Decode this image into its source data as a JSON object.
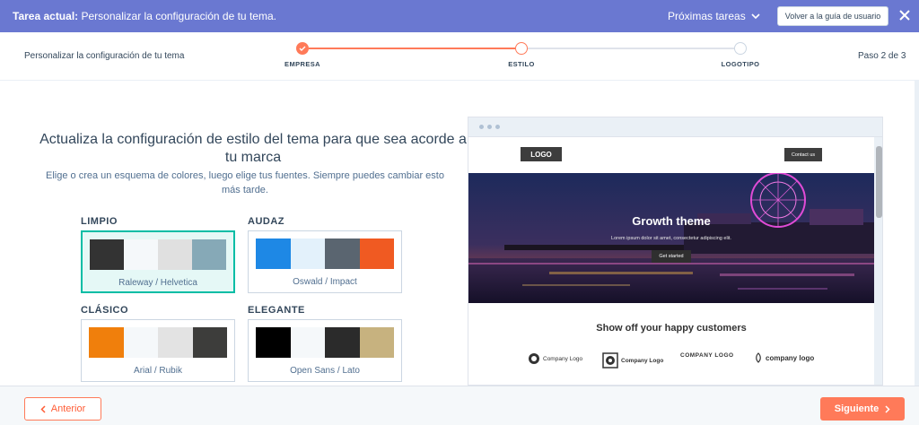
{
  "taskbar": {
    "task_prefix": "Tarea actual:",
    "task_text": "Personalizar la configuración de tu tema.",
    "next_tasks": "Próximas tareas",
    "guide_button": "Volver a la guía de usuario"
  },
  "stepper": {
    "left_label": "Personalizar la configuración de tu tema",
    "right_label": "Paso 2 de 3",
    "steps": [
      {
        "label": "EMPRESA",
        "state": "done"
      },
      {
        "label": "ESTILO",
        "state": "current"
      },
      {
        "label": "LOGOTIPO",
        "state": "pending"
      }
    ]
  },
  "main": {
    "heading": "Actualiza la configuración de estilo del tema para que sea acorde a tu marca",
    "subheading": "Elige o crea un esquema de colores, luego elige tus fuentes. Siempre puedes cambiar esto más tarde."
  },
  "themes": [
    {
      "name": "LIMPIO",
      "fonts": "Raleway / Helvetica",
      "selected": true,
      "colors": [
        "#333333",
        "#f5f8fa",
        "#e0e0e0",
        "#86a9b7"
      ]
    },
    {
      "name": "AUDAZ",
      "fonts": "Oswald / Impact",
      "selected": false,
      "colors": [
        "#1e88e5",
        "#e3f1fb",
        "#5a6570",
        "#f05a22"
      ]
    },
    {
      "name": "CLÁSICO",
      "fonts": "Arial / Rubik",
      "selected": false,
      "colors": [
        "#f07f0c",
        "#f5f8fa",
        "#e3e3e3",
        "#3d3d3b"
      ]
    },
    {
      "name": "ELEGANTE",
      "fonts": "Open Sans / Lato",
      "selected": false,
      "colors": [
        "#000000",
        "#f5f8fa",
        "#2b2b2b",
        "#c7b27f"
      ]
    }
  ],
  "preview": {
    "logo": "LOGO",
    "contact": "Contact us",
    "hero_title": "Growth theme",
    "hero_sub": "Lorem ipsum dolor sit amet, consectetur adipiscing elit.",
    "hero_button": "Get started",
    "section_title": "Show off your happy customers",
    "company_logos": [
      "Company Logo",
      "Company Logo",
      "COMPANY LOGO",
      "company logo"
    ]
  },
  "footer": {
    "prev": "Anterior",
    "next": "Siguiente"
  },
  "colors": {
    "accent": "#ff7a59",
    "taskbar": "#6a78d1",
    "selected_border": "#00bda5"
  }
}
